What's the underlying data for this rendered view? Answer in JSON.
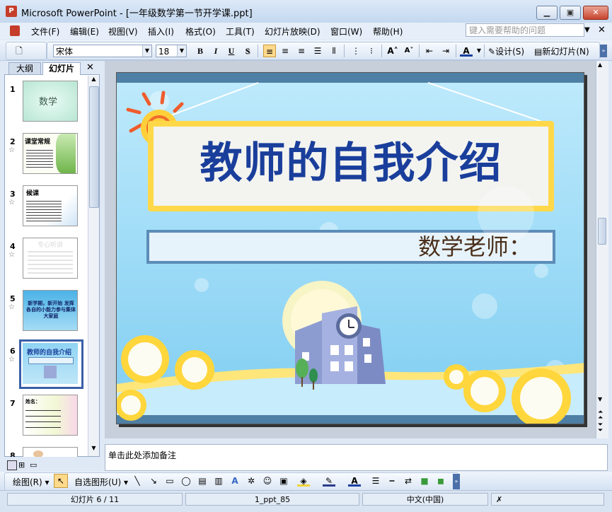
{
  "window": {
    "title": "Microsoft PowerPoint - [一年级数学第一节开学课.ppt]",
    "app_icon": "powerpoint-icon"
  },
  "menu": {
    "items": [
      "文件(F)",
      "编辑(E)",
      "视图(V)",
      "插入(I)",
      "格式(O)",
      "工具(T)",
      "幻灯片放映(D)",
      "窗口(W)",
      "帮助(H)"
    ],
    "help_placeholder": "键入需要帮助的问题"
  },
  "toolbar": {
    "font_name": "宋体",
    "font_size": "18",
    "bold": "B",
    "italic": "I",
    "underline": "U",
    "shadow": "S",
    "design_label": "设计(S)",
    "new_slide_label": "新幻灯片(N)"
  },
  "left_pane": {
    "tabs": [
      "大纲",
      "幻灯片"
    ],
    "active_tab": "幻灯片",
    "slides": [
      {
        "num": "1",
        "text": "数学"
      },
      {
        "num": "2",
        "text": "课堂常规"
      },
      {
        "num": "3",
        "text": "候课"
      },
      {
        "num": "4",
        "text": "专心听讲"
      },
      {
        "num": "5",
        "text": "新学期，新开始 发挥各自的小能力参与集体大家庭"
      },
      {
        "num": "6",
        "text": "教师的自我介绍",
        "selected": true
      },
      {
        "num": "7",
        "text": "姓名："
      },
      {
        "num": "8",
        "text": ""
      }
    ]
  },
  "slide": {
    "title": "教师的自我介绍",
    "subtitle": "数学老师："
  },
  "notes": {
    "placeholder": "单击此处添加备注"
  },
  "drawing_toolbar": {
    "draw_label": "绘图(R)",
    "autoshape_label": "自选图形(U)"
  },
  "status": {
    "slide_pos": "幻灯片 6 / 11",
    "template": "1_ppt_85",
    "language": "中文(中国)"
  },
  "colors": {
    "title_text": "#1a3e9b",
    "slide_bg": "#8fd4f4",
    "selection": "#3a5fa8"
  }
}
